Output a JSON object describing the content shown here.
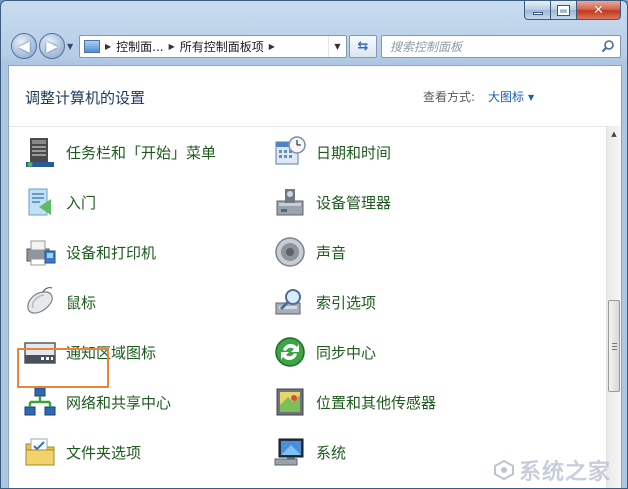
{
  "window": {
    "minimize_icon": "minimize-icon",
    "maximize_icon": "maximize-icon",
    "close_icon": "close-icon"
  },
  "nav": {
    "back_icon": "back-arrow-icon",
    "forward_icon": "forward-arrow-icon",
    "breadcrumb": [
      "控制面...",
      "所有控制面板项"
    ],
    "search_placeholder": "搜索控制面板"
  },
  "header": {
    "title": "调整计算机的设置",
    "view_label": "查看方式:",
    "view_value": "大图标"
  },
  "items": [
    {
      "label": "任务栏和「开始」菜单",
      "icon": "taskbar-start-icon"
    },
    {
      "label": "日期和时间",
      "icon": "calendar-clock-icon"
    },
    {
      "label": "入门",
      "icon": "getting-started-icon"
    },
    {
      "label": "设备管理器",
      "icon": "device-manager-icon"
    },
    {
      "label": "设备和打印机",
      "icon": "printer-icon"
    },
    {
      "label": "声音",
      "icon": "speaker-icon"
    },
    {
      "label": "鼠标",
      "icon": "mouse-icon"
    },
    {
      "label": "索引选项",
      "icon": "indexing-icon"
    },
    {
      "label": "通知区域图标",
      "icon": "notification-area-icon"
    },
    {
      "label": "同步中心",
      "icon": "sync-center-icon"
    },
    {
      "label": "网络和共享中心",
      "icon": "network-sharing-icon"
    },
    {
      "label": "位置和其他传感器",
      "icon": "location-sensor-icon"
    },
    {
      "label": "文件夹选项",
      "icon": "folder-options-icon"
    },
    {
      "label": "系统",
      "icon": "system-icon"
    }
  ],
  "highlighted_item": "鼠标",
  "colors": {
    "link_green": "#1e5a1e",
    "title_blue": "#1e395b",
    "accent_blue": "#1e5eb8",
    "highlight_orange": "#e8853a"
  },
  "watermark": "系统之家"
}
